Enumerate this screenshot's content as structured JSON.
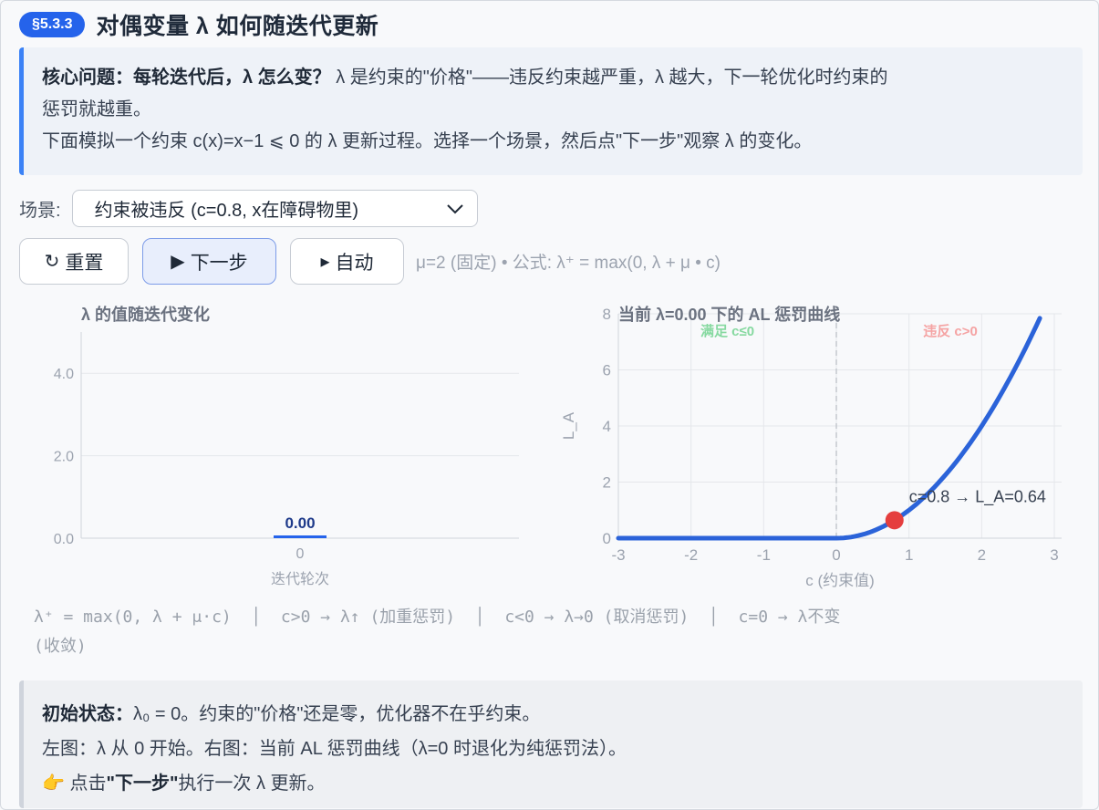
{
  "header": {
    "badge": "§5.3.3",
    "title": "对偶变量 λ 如何随迭代更新"
  },
  "intro": {
    "bold": "核心问题：每轮迭代后，λ 怎么变？",
    "text1": "λ 是约束的\"价格\"——违反约束越严重，λ 越大，下一轮优化时约束的",
    "text2": "惩罚就越重。",
    "text3": "下面模拟一个约束 c(x)=x−1 ⩽ 0 的 λ 更新过程。选择一个场景，然后点\"下一步\"观察 λ 的变化。"
  },
  "scene": {
    "label": "场景:",
    "selected": "约束被违反 (c=0.8, x在障碍物里)"
  },
  "buttons": {
    "reset": "重置",
    "reset_icon": "↻",
    "step": "下一步",
    "step_icon": "▶",
    "auto": "自动",
    "auto_icon": "▸"
  },
  "formula_note": "μ=2 (固定) • 公式: λ⁺ = max(0, λ + μ • c)",
  "chart_data": [
    {
      "type": "bar",
      "title": "λ 的值随迭代变化",
      "xlabel": "迭代轮次",
      "ylabel": "",
      "categories": [
        "0"
      ],
      "values": [
        0.0
      ],
      "value_labels": [
        "0.00"
      ],
      "ylim": [
        0,
        5
      ],
      "yticks": [
        "0.0",
        "2.0",
        "4.0"
      ],
      "grid": true
    },
    {
      "type": "line",
      "title": "当前 λ=0.00 下的 AL 惩罚曲线",
      "xlabel": "c (约束值)",
      "ylabel": "L_A",
      "xlim": [
        -3,
        3.1
      ],
      "ylim": [
        0,
        8
      ],
      "xticks": [
        "-3",
        "-2",
        "-1",
        "0",
        "1",
        "2",
        "3"
      ],
      "yticks": [
        "0",
        "2",
        "4",
        "6",
        "8"
      ],
      "series": [
        {
          "x": [
            -3,
            -2,
            -1,
            0,
            0.4,
            0.8,
            1.2,
            1.6,
            2.0,
            2.4,
            2.8
          ],
          "y": [
            0,
            0,
            0,
            0,
            0.16,
            0.64,
            1.44,
            2.56,
            4.0,
            5.76,
            7.84
          ]
        }
      ],
      "marker": {
        "x": 0.8,
        "y": 0.64,
        "label": "c=0.8 → L_A=0.64"
      },
      "region_left": "满足 c≤0",
      "region_right": "违反 c>0",
      "grid": true
    }
  ],
  "legend": {
    "line1": "λ⁺ = max(0, λ + μ·c)  │  c>0 → λ↑ (加重惩罚)  │  c<0 → λ→0 (取消惩罚)  │  c=0 → λ不变",
    "line2": "(收敛)"
  },
  "state": {
    "bold1": "初始状态：",
    "text1": "λ₀ = 0。约束的\"价格\"还是零，优化器不在乎约束。",
    "text2": "左图：λ 从 0 开始。右图：当前 AL 惩罚曲线（λ=0 时退化为纯惩罚法）。",
    "icon": "👉",
    "text3a": " 点击",
    "bold3": "\"下一步\"",
    "text3b": "执行一次 λ 更新。"
  },
  "colors": {
    "accent": "#2563eb",
    "curve": "#2b63d9",
    "marker": "#e53e3e",
    "ok": "#86d9a0",
    "bad": "#f5a3a3"
  }
}
